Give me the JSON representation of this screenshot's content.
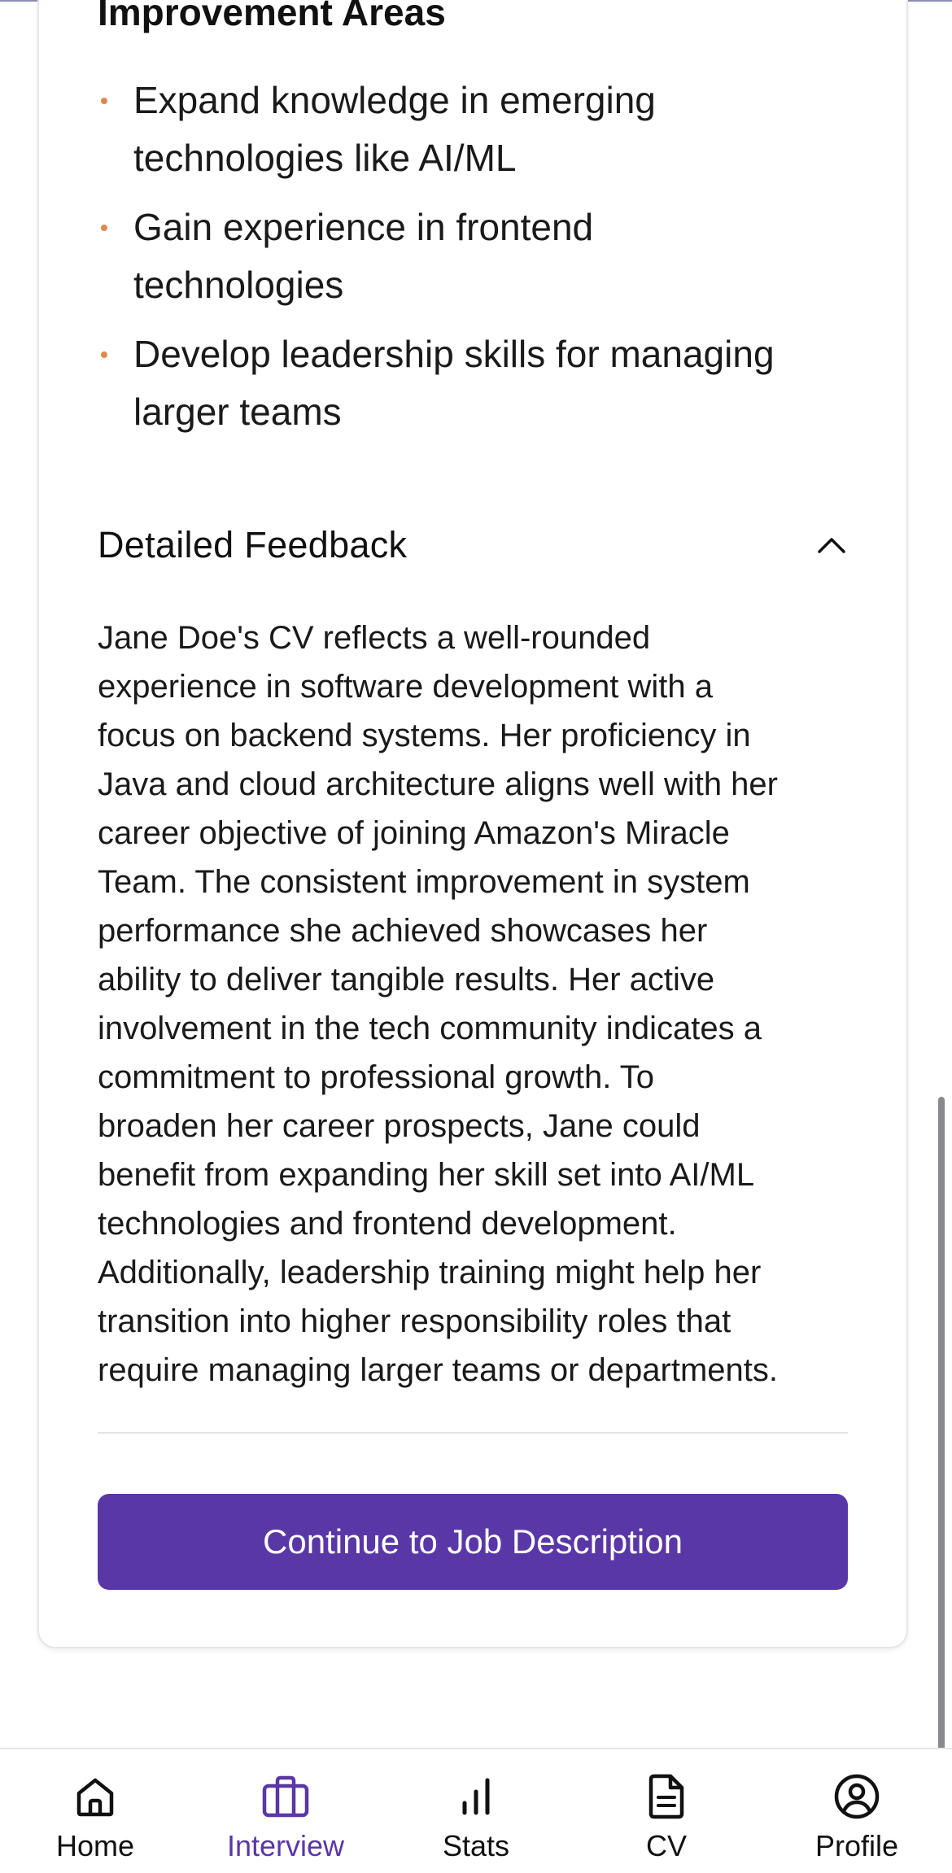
{
  "improvement": {
    "title": "Improvement Areas",
    "items": [
      {
        "line1": "Expand knowledge in emerging",
        "line2": "technologies like AI/ML"
      },
      {
        "line1": "Gain experience in frontend",
        "line2": "technologies"
      },
      {
        "line1": "Develop leadership skills for managing",
        "line2": "larger teams"
      }
    ]
  },
  "feedback": {
    "title": "Detailed Feedback",
    "expanded": true,
    "lines": [
      "Jane Doe's CV reflects a well-rounded",
      "experience in software development with a",
      "focus on backend systems. Her proficiency in",
      "Java and cloud architecture aligns well with her",
      "career objective of joining Amazon's Miracle",
      "Team. The consistent improvement in system",
      "performance she achieved showcases her",
      "ability to deliver tangible results. Her active",
      "involvement in the tech community indicates a",
      "commitment to professional growth. To",
      "broaden her career prospects, Jane could",
      "benefit from expanding her skill set into AI/ML",
      "technologies and frontend development.",
      "Additionally, leadership training might help her",
      "transition into higher responsibility roles that",
      "require managing larger teams or departments."
    ]
  },
  "cta": {
    "label": "Continue to Job Description"
  },
  "tabbar": {
    "active": "interview",
    "tabs": [
      {
        "id": "home",
        "label": "Home",
        "icon": "home-icon"
      },
      {
        "id": "interview",
        "label": "Interview",
        "icon": "briefcase-icon"
      },
      {
        "id": "stats",
        "label": "Stats",
        "icon": "bar-chart-icon"
      },
      {
        "id": "cv",
        "label": "CV",
        "icon": "document-icon"
      },
      {
        "id": "profile",
        "label": "Profile",
        "icon": "user-circle-icon"
      }
    ]
  },
  "colors": {
    "accent": "#5a37a6",
    "bullet": "#e0894a",
    "text": "#1a1a1a",
    "divider": "#e4e4e8"
  }
}
